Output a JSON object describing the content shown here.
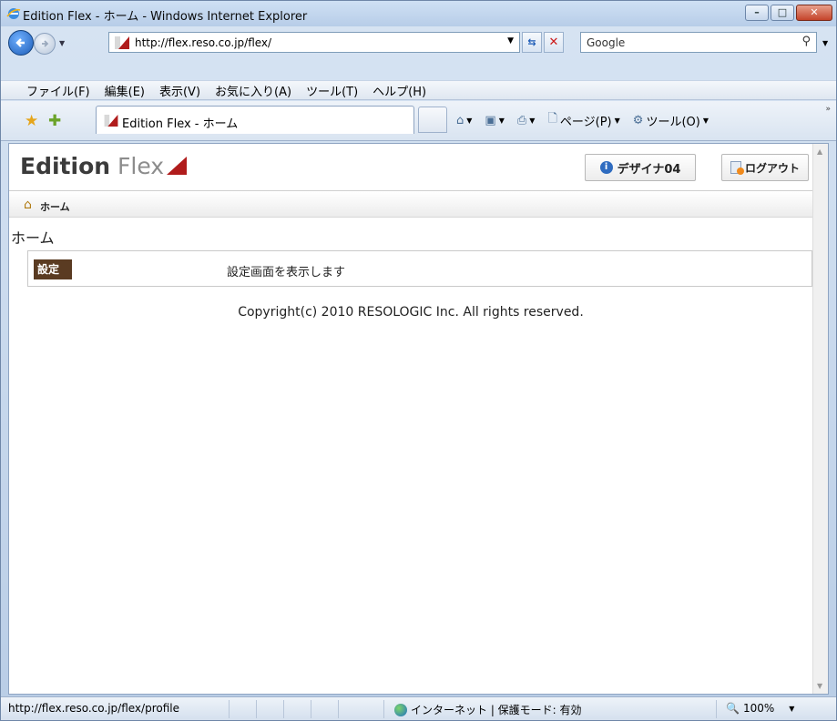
{
  "window": {
    "title": "Edition Flex - ホーム - Windows Internet Explorer",
    "minimize_glyph": "–",
    "maximize_glyph": "□",
    "close_glyph": "✕"
  },
  "addressbar": {
    "url": "http://flex.reso.co.jp/flex/",
    "search_placeholder": "Google"
  },
  "menubar": {
    "items": [
      "ファイル(F)",
      "編集(E)",
      "表示(V)",
      "お気に入り(A)",
      "ツール(T)",
      "ヘルプ(H)"
    ]
  },
  "tab": {
    "title": "Edition Flex - ホーム"
  },
  "commandbar": {
    "page_label": "ページ(P)",
    "tools_label": "ツール(O)"
  },
  "app": {
    "logo_bold": "Edition",
    "logo_light": " Flex",
    "user_label": "デザイナ04",
    "logout_label": "ログアウト",
    "breadcrumb_home": "ホーム",
    "page_title": "ホーム",
    "settings_button": "設定",
    "settings_description": "設定画面を表示します",
    "copyright": "Copyright(c) 2010 RESOLOGIC Inc. All rights reserved."
  },
  "statusbar": {
    "url": "http://flex.reso.co.jp/flex/profile",
    "zone": "インターネット | 保護モード: 有効",
    "zoom": "100%"
  },
  "colors": {
    "logo_accent": "#b01c1c",
    "settings_button_bg": "#5a3b22"
  }
}
